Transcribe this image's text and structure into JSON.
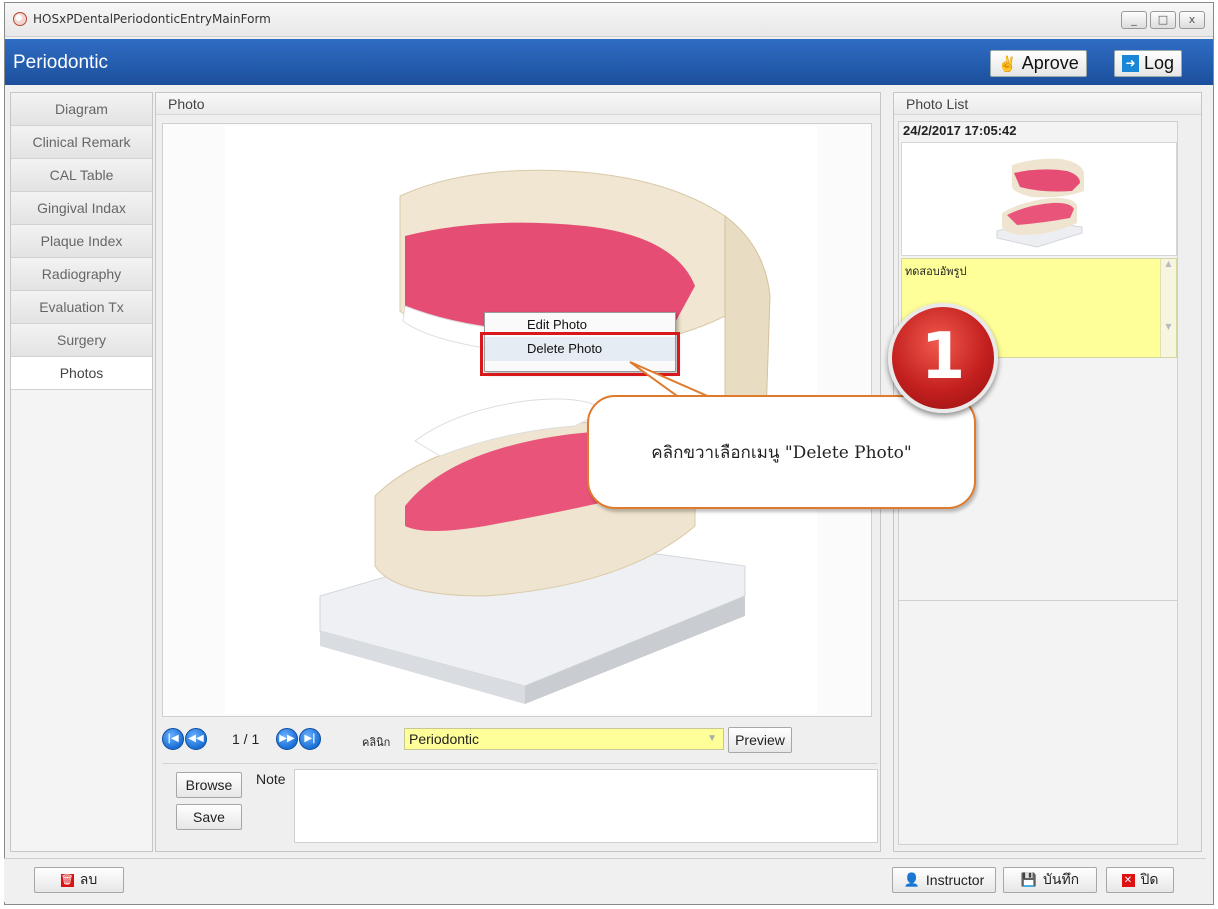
{
  "window": {
    "title": "HOSxPDentalPeriodonticEntryMainForm",
    "controls": [
      "_",
      "□",
      "x"
    ]
  },
  "header": {
    "title": "Periodontic",
    "approve_label": "Aprove",
    "log_label": "Log"
  },
  "tabs": [
    {
      "label": "Diagram"
    },
    {
      "label": "Clinical Remark"
    },
    {
      "label": "CAL Table"
    },
    {
      "label": "Gingival Indax"
    },
    {
      "label": "Plaque Index"
    },
    {
      "label": "Radiography"
    },
    {
      "label": "Evaluation Tx"
    },
    {
      "label": "Surgery"
    },
    {
      "label": "Photos",
      "active": true
    }
  ],
  "photo": {
    "panel_title": "Photo",
    "page_indicator": "1 / 1",
    "clinic_label": "คลินิก",
    "clinic_value": "Periodontic",
    "preview_label": "Preview",
    "browse_label": "Browse",
    "save_label": "Save",
    "note_label": "Note",
    "note_value": ""
  },
  "context_menu": {
    "items": [
      "Edit Photo",
      "Delete Photo"
    ],
    "highlighted": "Delete Photo"
  },
  "callout": {
    "text": "คลิกขวาเลือกเมนู \"Delete Photo\""
  },
  "step_badge": {
    "number": "1"
  },
  "photo_list": {
    "panel_title": "Photo List",
    "items": [
      {
        "date": "24/2/2017 17:05:42",
        "note": "ทดสอบอัพรูป"
      }
    ]
  },
  "bottom": {
    "delete_label": "ลบ",
    "instructor_label": "Instructor",
    "save_label": "บันทึก",
    "close_label": "ปิด"
  },
  "colors": {
    "header_blue": "#1c4f9c",
    "field_yellow": "#ffff99",
    "highlight_red": "#d8181b",
    "callout_orange": "#e07a2c"
  }
}
